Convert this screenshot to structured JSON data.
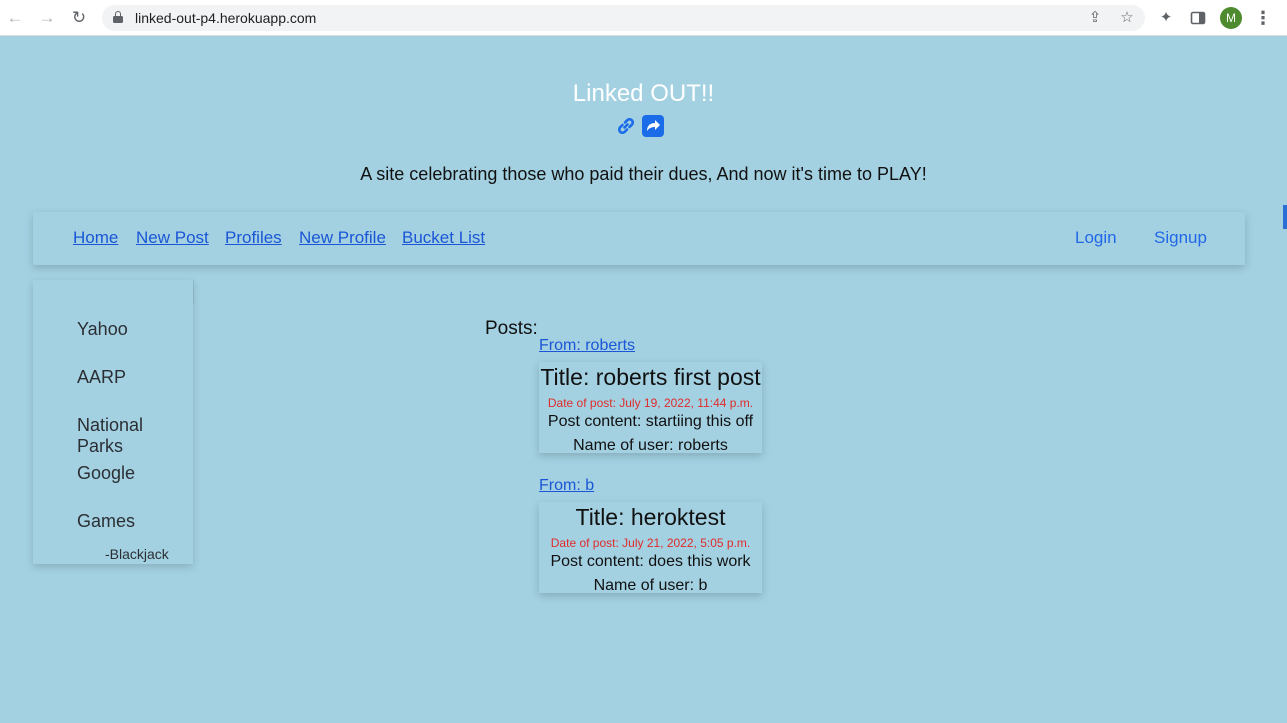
{
  "browser": {
    "url": "linked-out-p4.herokuapp.com",
    "profile_initial": "M",
    "icons": {
      "back": "arrow-left-icon",
      "forward": "arrow-right-icon",
      "reload": "reload-icon",
      "lock": "lock-icon",
      "share": "share-icon",
      "bookmark": "star-icon",
      "extensions": "puzzle-icon",
      "side_panel": "side-panel-icon",
      "menu": "kebab-menu-icon"
    }
  },
  "header": {
    "title": "Linked OUT!!",
    "tagline": "A site celebrating those who paid their dues, And now it's time to PLAY!",
    "icons": [
      "link-icon",
      "share-square-icon"
    ]
  },
  "nav": {
    "left": [
      "Home",
      "New Post",
      "Profiles",
      "New Profile",
      "Bucket List"
    ],
    "right": [
      "Login",
      "Signup"
    ]
  },
  "sidebar": {
    "items": [
      "Yahoo",
      "AARP",
      "National Parks",
      "Google",
      "Games"
    ],
    "sub_item": "-Blackjack"
  },
  "posts": {
    "heading": "Posts:",
    "items": [
      {
        "from": "From: roberts",
        "title": "Title: roberts first post",
        "date": "Date of post: July 19, 2022, 11:44 p.m.",
        "content": "Post content: startiing this off",
        "user": "Name of user: roberts"
      },
      {
        "from": "From: b",
        "title": "Title: heroktest",
        "date": "Date of post: July 21, 2022, 5:05 p.m.",
        "content": "Post content: does this work",
        "user": "Name of user: b"
      }
    ]
  },
  "colors": {
    "page_bg": "#a3d1e2",
    "link": "#1a56d6",
    "date_red": "#e02b2b",
    "icon_blue": "#1a6ce8"
  }
}
